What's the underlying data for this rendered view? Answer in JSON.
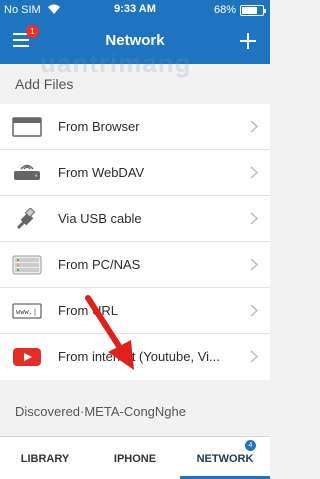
{
  "status": {
    "carrier": "No SIM",
    "time": "9:33 AM",
    "battery": "68%",
    "battery_level": 0.68
  },
  "navbar": {
    "title": "Network",
    "menu_badge": "1"
  },
  "section_title": "Add Files",
  "items": [
    {
      "label": "From Browser",
      "icon": "browser-window-icon"
    },
    {
      "label": "From WebDAV",
      "icon": "webdav-drive-icon"
    },
    {
      "label": "Via USB cable",
      "icon": "usb-cable-icon"
    },
    {
      "label": "From PC/NAS",
      "icon": "nas-server-icon"
    },
    {
      "label": "From URL",
      "icon": "url-www-icon"
    },
    {
      "label": "From internet (Youtube, Vi...",
      "icon": "youtube-play-icon"
    }
  ],
  "discovered": "Discovered·META-CongNghe",
  "tabs": [
    {
      "label": "LIBRARY"
    },
    {
      "label": "IPHONE"
    },
    {
      "label": "NETWORK",
      "badge": "4"
    }
  ],
  "watermark": "uantrimang",
  "colors": {
    "accent": "#1e74be",
    "annotation_arrow": "#e0201b",
    "badge_red": "#e5332a"
  }
}
